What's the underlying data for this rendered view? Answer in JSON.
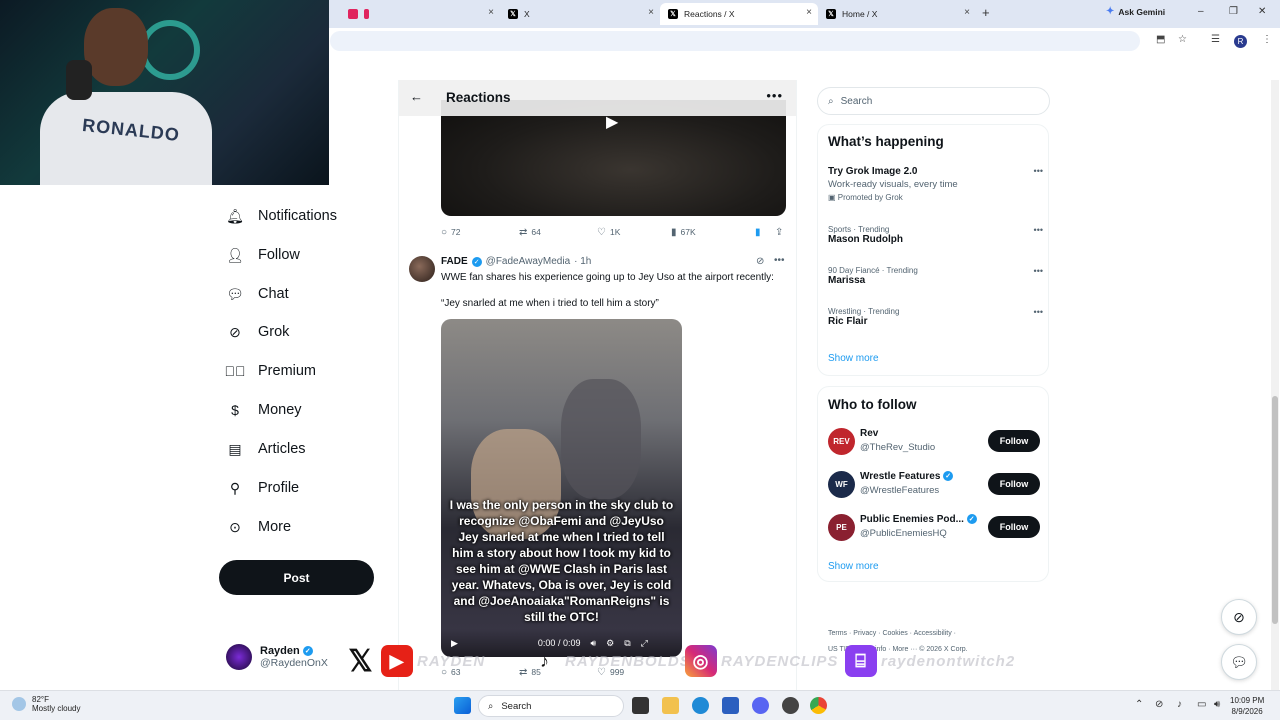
{
  "browser": {
    "tabs": [
      {
        "title": "",
        "close": "×"
      },
      {
        "title": "X",
        "close": "×"
      },
      {
        "title": "Reactions / X",
        "close": "×"
      },
      {
        "title": "Home / X",
        "close": "×"
      }
    ],
    "new_tab": "+",
    "gemini_label": "Ask Gemini",
    "window_controls": [
      "–",
      "❐",
      "✕"
    ],
    "profile_initial": "R"
  },
  "webcam": {
    "shirt_text": "RONALDO"
  },
  "nav": {
    "items": [
      {
        "label": "Notifications",
        "icon": "bell-icon"
      },
      {
        "label": "Follow",
        "icon": "person-plus-icon"
      },
      {
        "label": "Chat",
        "icon": "chat-icon"
      },
      {
        "label": "Grok",
        "icon": "grok-icon"
      },
      {
        "label": "Premium",
        "icon": "premium-icon"
      },
      {
        "label": "Money",
        "icon": "money-icon"
      },
      {
        "label": "Articles",
        "icon": "articles-icon"
      },
      {
        "label": "Profile",
        "icon": "profile-icon"
      },
      {
        "label": "More",
        "icon": "more-icon"
      }
    ],
    "post_label": "Post",
    "account": {
      "name": "Rayden",
      "handle": "@RaydenOnX"
    }
  },
  "main": {
    "header_title": "Reactions",
    "first_post_stats": {
      "replies": "72",
      "reposts": "64",
      "likes": "1K",
      "views": "67K"
    },
    "tweet": {
      "name": "FADE",
      "handle": "@FadeAwayMedia",
      "time": "· 1h",
      "text1": "WWE fan shares his experience going up to Jey Uso at the airport recently:",
      "text2": "“Jey snarled at me when i tried to tell him a story”",
      "caption": "I was the only person in the sky club to recognize @ObaFemi and @JeyUso Jey snarled at me when I tried to tell him a story about how I took my kid to see him at @WWE Clash in Paris last year. Whatevs, Oba is over, Jey is cold and @JoeAnoaiaka\"RomanReigns\" is still the OTC!",
      "video_time": "0:00 / 0:09",
      "stats": {
        "replies": "63",
        "reposts": "85",
        "likes": "999"
      }
    }
  },
  "sidebar": {
    "search_placeholder": "Search",
    "happening_title": "What’s happening",
    "trends": [
      {
        "context": "",
        "name": "Try Grok Image 2.0",
        "sub": "Work-ready visuals, every time",
        "promo": "Promoted by Grok"
      },
      {
        "context": "Sports · Trending",
        "name": "Mason Rudolph",
        "sub": "",
        "promo": ""
      },
      {
        "context": "90 Day Fiancé · Trending",
        "name": "Marissa",
        "sub": "",
        "promo": ""
      },
      {
        "context": "Wrestling · Trending",
        "name": "Ric Flair",
        "sub": "",
        "promo": ""
      }
    ],
    "show_more": "Show more",
    "who_to_follow_title": "Who to follow",
    "follow_suggestions": [
      {
        "name": "Rev",
        "handle": "@TheRev_Studio",
        "verified": false,
        "avatar_text": "REV",
        "avatar_color": "#c0262d"
      },
      {
        "name": "Wrestle Features",
        "handle": "@WrestleFeatures",
        "verified": true,
        "avatar_text": "WF",
        "avatar_color": "#1b2a4a"
      },
      {
        "name": "Public Enemies Pod...",
        "handle": "@PublicEnemiesHQ",
        "verified": true,
        "avatar_text": "PE",
        "avatar_color": "#8a2030"
      }
    ],
    "follow_label": "Follow",
    "footer": {
      "line1": "Terms · Privacy · Cookies · Accessibility ·",
      "line2": "US TIDA · Ads info · More ··· © 2026 X Corp."
    }
  },
  "overlay": {
    "handles": [
      "RAYDEN",
      "RAYDENBOLDS1",
      "RAYDENCLIPS",
      "raydenontwitch2"
    ]
  },
  "taskbar": {
    "weather_temp": "82°F",
    "weather_desc": "Mostly cloudy",
    "search_label": "Search",
    "time": "10:09 PM",
    "date": "8/9/2026"
  },
  "colors": {
    "accent": "#1d9bf0",
    "text": "#0f1419",
    "muted": "#536471",
    "button": "#0f1419"
  }
}
